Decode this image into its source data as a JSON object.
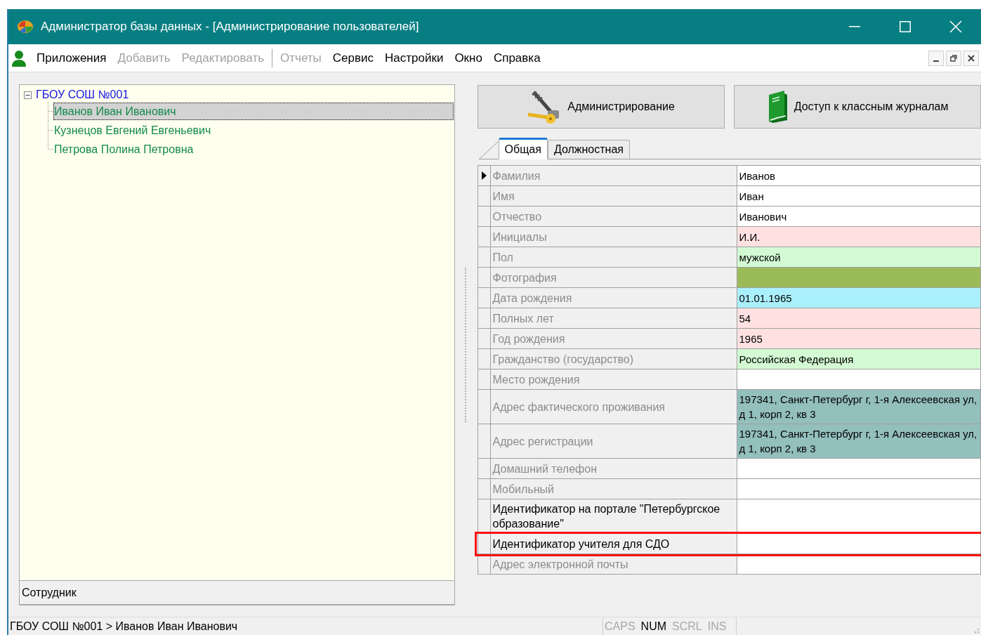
{
  "window": {
    "title": "Администратор базы данных - [Администрирование пользователей]"
  },
  "menu": [
    {
      "label": "Приложения",
      "disabled": false,
      "separator_after": false
    },
    {
      "label": "Добавить",
      "disabled": true,
      "separator_after": false
    },
    {
      "label": "Редактировать",
      "disabled": true,
      "separator_after": true
    },
    {
      "label": "Отчеты",
      "disabled": true,
      "separator_after": false
    },
    {
      "label": "Сервис",
      "disabled": false,
      "separator_after": false
    },
    {
      "label": "Настройки",
      "disabled": false,
      "separator_after": false
    },
    {
      "label": "Окно",
      "disabled": false,
      "separator_after": false
    },
    {
      "label": "Справка",
      "disabled": false,
      "separator_after": false
    }
  ],
  "tree": {
    "label": "ГБОУ СОШ №001",
    "expanded": true,
    "children": [
      {
        "label": "Иванов  Иван  Иванович",
        "selected": true
      },
      {
        "label": "Кузнецов  Евгений  Евгеньевич",
        "selected": false
      },
      {
        "label": "Петрова  Полина  Петровна",
        "selected": false
      }
    ]
  },
  "tree_footer": "Сотрудник",
  "buttons": [
    {
      "kind": "keys",
      "label": "Администрирование"
    },
    {
      "kind": "journal",
      "label": "Доступ к классным журналам"
    }
  ],
  "tabs": [
    {
      "label": "Общая",
      "selected": true
    },
    {
      "label": "Должностная",
      "selected": false
    }
  ],
  "grid": {
    "rows": [
      {
        "label": "Фамилия",
        "value": "Иванов",
        "color": "#ffffff",
        "greyed": true,
        "selected": true,
        "highlighted": false
      },
      {
        "label": "Имя",
        "value": "Иван",
        "color": "#ffffff",
        "greyed": true,
        "selected": false,
        "highlighted": false
      },
      {
        "label": "Отчество",
        "value": "Иванович",
        "color": "#ffffff",
        "greyed": true,
        "selected": false,
        "highlighted": false
      },
      {
        "label": "Инициалы",
        "value": "И.И.",
        "color": "#ffe1e1",
        "greyed": true,
        "selected": false,
        "highlighted": false
      },
      {
        "label": "Пол",
        "value": "мужской",
        "color": "#d4fad4",
        "greyed": true,
        "selected": false,
        "highlighted": false
      },
      {
        "label": "Фотография",
        "color": "#9bbb59",
        "greyed": true,
        "selected": false,
        "highlighted": false
      },
      {
        "label": "Дата рождения",
        "value": "01.01.1965",
        "color": "#aaf0fc",
        "greyed": true,
        "selected": false,
        "highlighted": false
      },
      {
        "label": "Полных лет",
        "value": "54",
        "color": "#ffe1e1",
        "greyed": true,
        "selected": false,
        "highlighted": false
      },
      {
        "label": "Год рождения",
        "value": "1965",
        "color": "#ffe1e1",
        "greyed": true,
        "selected": false,
        "highlighted": false
      },
      {
        "label": "Гражданство (государство)",
        "value": "Российская Федерация",
        "color": "#d4fad4",
        "greyed": true,
        "selected": false,
        "highlighted": false
      },
      {
        "label": "Место рождения",
        "color": "#ffffff",
        "greyed": true,
        "selected": false,
        "highlighted": false
      },
      {
        "label": "Адрес фактического проживания",
        "value": "197341, Санкт-Петербург г, 1-я Алексеевская ул, д 1, корп 2, кв 3",
        "color": "#93bfbd",
        "greyed": true,
        "selected": false,
        "highlighted": false
      },
      {
        "label": "Адрес регистрации",
        "value": "197341, Санкт-Петербург г, 1-я Алексеевская ул, д 1, корп 2, кв 3",
        "color": "#93bfbd",
        "greyed": true,
        "selected": false,
        "highlighted": false
      },
      {
        "label": "Домашний телефон",
        "color": "#ffffff",
        "greyed": true,
        "selected": false,
        "highlighted": false
      },
      {
        "label": "Мобильный",
        "color": "#ffffff",
        "greyed": true,
        "selected": false,
        "highlighted": false
      },
      {
        "label": "Идентификатор на портале \"Петербургское образование\"",
        "color": "#ffffff",
        "greyed": false,
        "selected": false,
        "highlighted": false
      },
      {
        "label": "Идентификатор учителя для СДО",
        "color": "#ffffff",
        "greyed": false,
        "selected": false,
        "highlighted": true
      },
      {
        "label": "Адрес электронной почты",
        "color": "#ffffff",
        "greyed": true,
        "selected": false,
        "highlighted": false
      }
    ]
  },
  "status_bar": {
    "path": "ГБОУ СОШ №001 > Иванов  Иван  Иванович",
    "indicators": [
      {
        "label": "CAPS",
        "on": false
      },
      {
        "label": "NUM",
        "on": true
      },
      {
        "label": "SCRL",
        "on": false
      },
      {
        "label": "INS",
        "on": false
      }
    ]
  }
}
